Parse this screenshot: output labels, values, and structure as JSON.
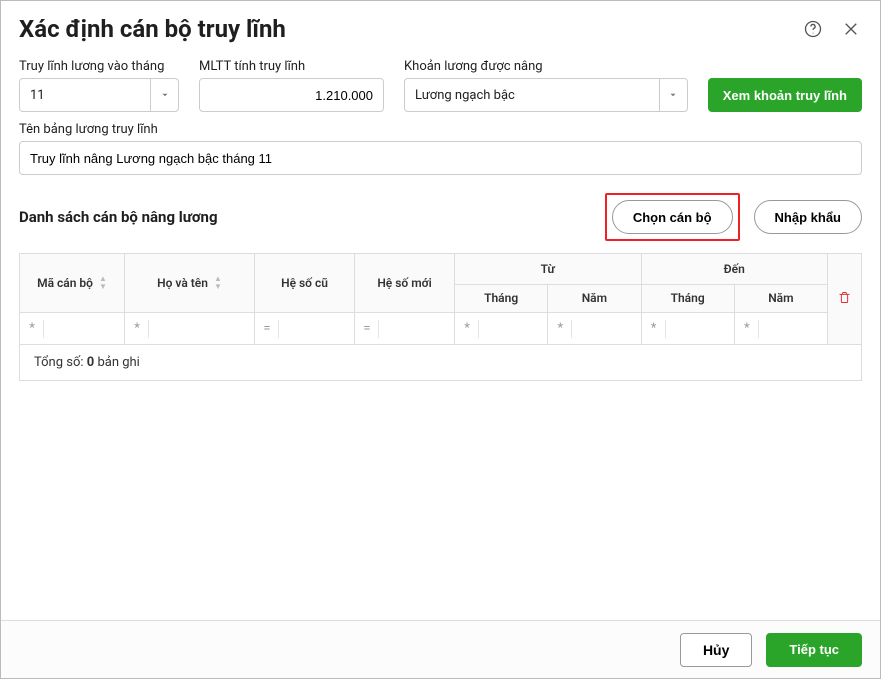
{
  "header": {
    "title": "Xác định cán bộ truy lĩnh"
  },
  "form": {
    "month_label": "Truy lĩnh lương vào tháng",
    "month_value": "11",
    "mltt_label": "MLTT tính truy lĩnh",
    "mltt_value": "1.210.000",
    "khoan_label": "Khoản lương được nâng",
    "khoan_value": "Lương ngạch bậc",
    "view_button": "Xem khoản truy lĩnh",
    "ten_bang_label": "Tên bảng lương truy lĩnh",
    "ten_bang_value": "Truy lĩnh nâng Lương ngạch bậc tháng 11"
  },
  "section": {
    "title": "Danh sách cán bộ nâng lương",
    "chon_can_bo": "Chọn cán bộ",
    "nhap_khau": "Nhập khẩu"
  },
  "table": {
    "headers": {
      "ma_can_bo": "Mã cán bộ",
      "ho_ten": "Họ và tên",
      "he_so_cu": "Hệ số cũ",
      "he_so_moi": "Hệ số mới",
      "tu": "Từ",
      "den": "Đến",
      "thang": "Tháng",
      "nam": "Năm"
    },
    "filter_ops": {
      "contains": "*",
      "equals": "="
    },
    "total_prefix": "Tổng số: ",
    "total_count": "0",
    "total_suffix": " bản ghi"
  },
  "footer": {
    "cancel": "Hủy",
    "continue": "Tiếp tục"
  }
}
